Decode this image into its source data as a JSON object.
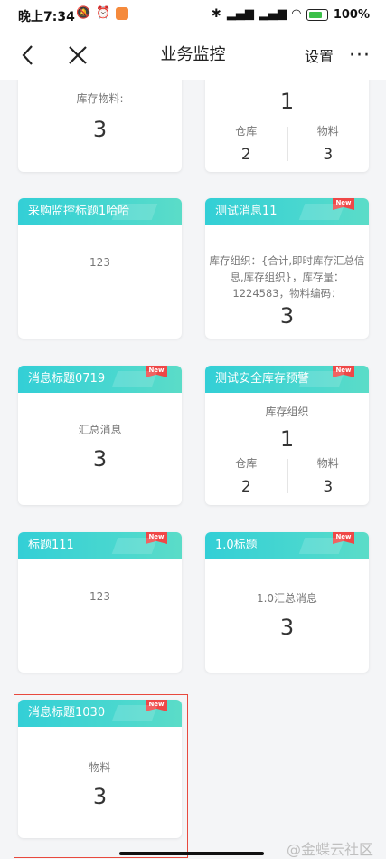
{
  "status": {
    "time": "晚上7:34",
    "battery": "100%",
    "network": "HD",
    "app_badge_color": "#f58a3c"
  },
  "nav": {
    "back_icon": "chevron-left-icon",
    "close_icon": "close-icon",
    "title": "业务监控",
    "settings": "设置",
    "more": "···"
  },
  "cards": {
    "c1": {
      "label": "库存物料:",
      "value": "3"
    },
    "c2": {
      "value": "1",
      "left_label": "仓库",
      "left_value": "2",
      "right_label": "物料",
      "right_value": "3"
    },
    "c3": {
      "title": "采购监控标题1哈哈",
      "body": "123"
    },
    "c4": {
      "title": "测试消息11",
      "badge": "New",
      "text": "库存组织：{合计,即时库存汇总信息,库存组织}，库存量：1224583，物料编码：",
      "value": "3"
    },
    "c5": {
      "title": "消息标题0719",
      "badge": "New",
      "label": "汇总消息",
      "value": "3"
    },
    "c6": {
      "title": "测试安全库存预警",
      "badge": "New",
      "label": "库存组织",
      "value": "1",
      "left_label": "仓库",
      "left_value": "2",
      "right_label": "物料",
      "right_value": "3"
    },
    "c7": {
      "title": "标题111",
      "badge": "New",
      "body": "123"
    },
    "c8": {
      "title": "1.0标题",
      "badge": "New",
      "label": "1.0汇总消息",
      "value": "3"
    },
    "c9": {
      "title": "消息标题1030",
      "badge": "New",
      "label": "物料",
      "value": "3"
    }
  },
  "watermark": "@金蝶云社区",
  "colors": {
    "header_gradient_start": "#33cfd6",
    "header_gradient_end": "#5bdcc8",
    "badge": "#ef4747",
    "highlight": "#e8493e"
  }
}
